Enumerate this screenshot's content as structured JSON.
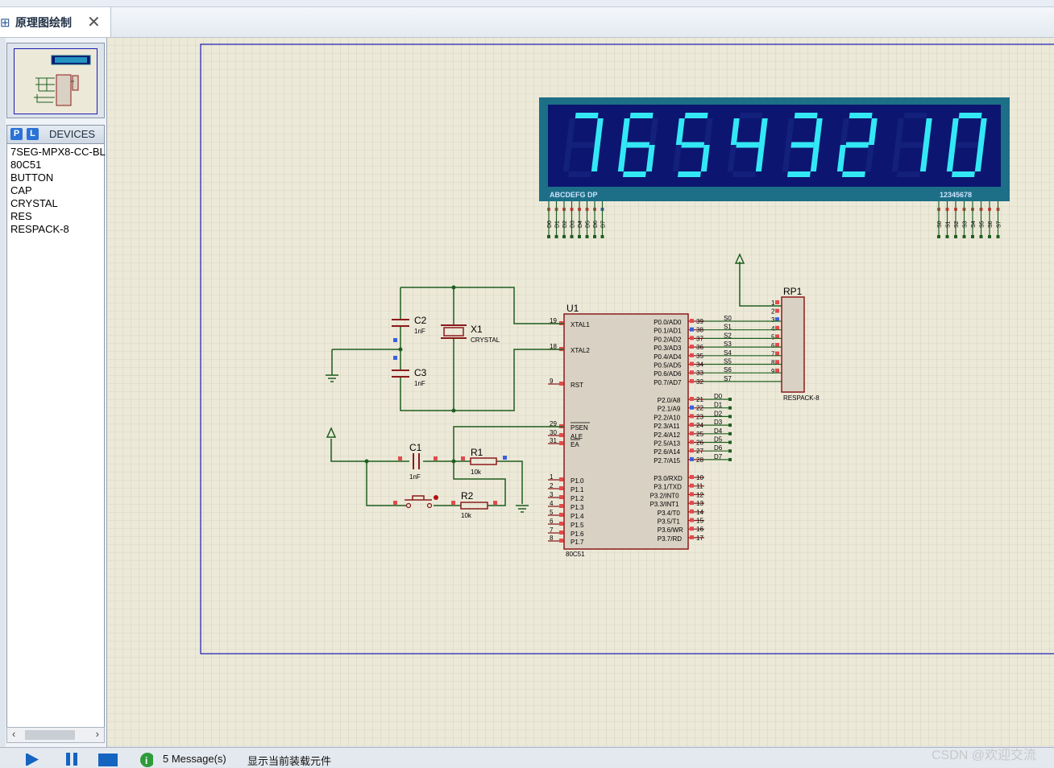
{
  "tab": {
    "icon": "schematic-icon",
    "title": "原理图绘制",
    "close": "✕"
  },
  "devices": {
    "p_label": "P",
    "l_label": "L",
    "header": "DEVICES",
    "items": [
      "7SEG-MPX8-CC-BL",
      "80C51",
      "BUTTON",
      "CAP",
      "CRYSTAL",
      "RES",
      "RESPACK-8"
    ]
  },
  "display": {
    "digits": [
      "7",
      "6",
      "5",
      "4",
      "3",
      "2",
      "1",
      "0"
    ],
    "seg_label": "ABCDEFG  DP",
    "com_label": "12345678",
    "seg_pins": [
      "D0",
      "D1",
      "D2",
      "D3",
      "D4",
      "D5",
      "D6",
      "D7"
    ],
    "com_pins": [
      "S0",
      "S1",
      "S2",
      "S3",
      "S4",
      "S5",
      "S6",
      "S7"
    ]
  },
  "mcu": {
    "ref": "U1",
    "part": "80C51",
    "left_pins": [
      {
        "num": "19",
        "name": "XTAL1"
      },
      {
        "num": "18",
        "name": "XTAL2"
      },
      {
        "num": "9",
        "name": "RST"
      },
      {
        "num": "29",
        "name": "PSEN"
      },
      {
        "num": "30",
        "name": "ALE"
      },
      {
        "num": "31",
        "name": "EA"
      },
      {
        "num": "1",
        "name": "P1.0"
      },
      {
        "num": "2",
        "name": "P1.1"
      },
      {
        "num": "3",
        "name": "P1.2"
      },
      {
        "num": "4",
        "name": "P1.3"
      },
      {
        "num": "5",
        "name": "P1.4"
      },
      {
        "num": "6",
        "name": "P1.5"
      },
      {
        "num": "7",
        "name": "P1.6"
      },
      {
        "num": "8",
        "name": "P1.7"
      }
    ],
    "right_pins": [
      {
        "num": "39",
        "name": "P0.0/AD0",
        "net": "S0"
      },
      {
        "num": "38",
        "name": "P0.1/AD1",
        "net": "S1"
      },
      {
        "num": "37",
        "name": "P0.2/AD2",
        "net": "S2"
      },
      {
        "num": "36",
        "name": "P0.3/AD3",
        "net": "S3"
      },
      {
        "num": "35",
        "name": "P0.4/AD4",
        "net": "S4"
      },
      {
        "num": "34",
        "name": "P0.5/AD5",
        "net": "S5"
      },
      {
        "num": "33",
        "name": "P0.6/AD6",
        "net": "S6"
      },
      {
        "num": "32",
        "name": "P0.7/AD7",
        "net": "S7"
      },
      {
        "num": "21",
        "name": "P2.0/A8",
        "net": "D0"
      },
      {
        "num": "22",
        "name": "P2.1/A9",
        "net": "D1"
      },
      {
        "num": "23",
        "name": "P2.2/A10",
        "net": "D2"
      },
      {
        "num": "24",
        "name": "P2.3/A11",
        "net": "D3"
      },
      {
        "num": "25",
        "name": "P2.4/A12",
        "net": "D4"
      },
      {
        "num": "26",
        "name": "P2.5/A13",
        "net": "D5"
      },
      {
        "num": "27",
        "name": "P2.6/A14",
        "net": "D6"
      },
      {
        "num": "28",
        "name": "P2.7/A15",
        "net": "D7"
      },
      {
        "num": "10",
        "name": "P3.0/RXD",
        "net": ""
      },
      {
        "num": "11",
        "name": "P3.1/TXD",
        "net": ""
      },
      {
        "num": "12",
        "name": "P3.2/INT0",
        "net": ""
      },
      {
        "num": "13",
        "name": "P3.3/INT1",
        "net": ""
      },
      {
        "num": "14",
        "name": "P3.4/T0",
        "net": ""
      },
      {
        "num": "15",
        "name": "P3.5/T1",
        "net": ""
      },
      {
        "num": "16",
        "name": "P3.6/WR",
        "net": ""
      },
      {
        "num": "17",
        "name": "P3.7/RD",
        "net": ""
      }
    ]
  },
  "rp1": {
    "ref": "RP1",
    "part": "RESPACK-8",
    "pins": [
      "1",
      "2",
      "3",
      "4",
      "5",
      "6",
      "7",
      "8",
      "9"
    ]
  },
  "components": {
    "c2": {
      "ref": "C2",
      "value": "1nF"
    },
    "c3": {
      "ref": "C3",
      "value": "1nF"
    },
    "x1": {
      "ref": "X1",
      "value": "CRYSTAL"
    },
    "c1": {
      "ref": "C1",
      "value": "1nF"
    },
    "r1": {
      "ref": "R1",
      "value": "10k"
    },
    "r2": {
      "ref": "R2",
      "value": "10k"
    }
  },
  "status": {
    "play_icon": "play-step-icon",
    "pause_icon": "pause-icon",
    "stop_icon": "stop-icon",
    "info_icon": "info-icon",
    "messages": "5 Message(s)",
    "hint": "显示当前装载元件"
  },
  "watermark": "CSDN @欢迎交流",
  "colors": {
    "sheet_bg": "#ece9d8",
    "grid": "#c8c4b4",
    "border": "#1b1bb5",
    "wire": "#1f5e1f",
    "component": "#8b1a1a",
    "chip_fill": "#d9d1c3",
    "display_frame": "#1c6f86",
    "display_bg": "#0c1670",
    "segment_on": "#33e8f5"
  }
}
